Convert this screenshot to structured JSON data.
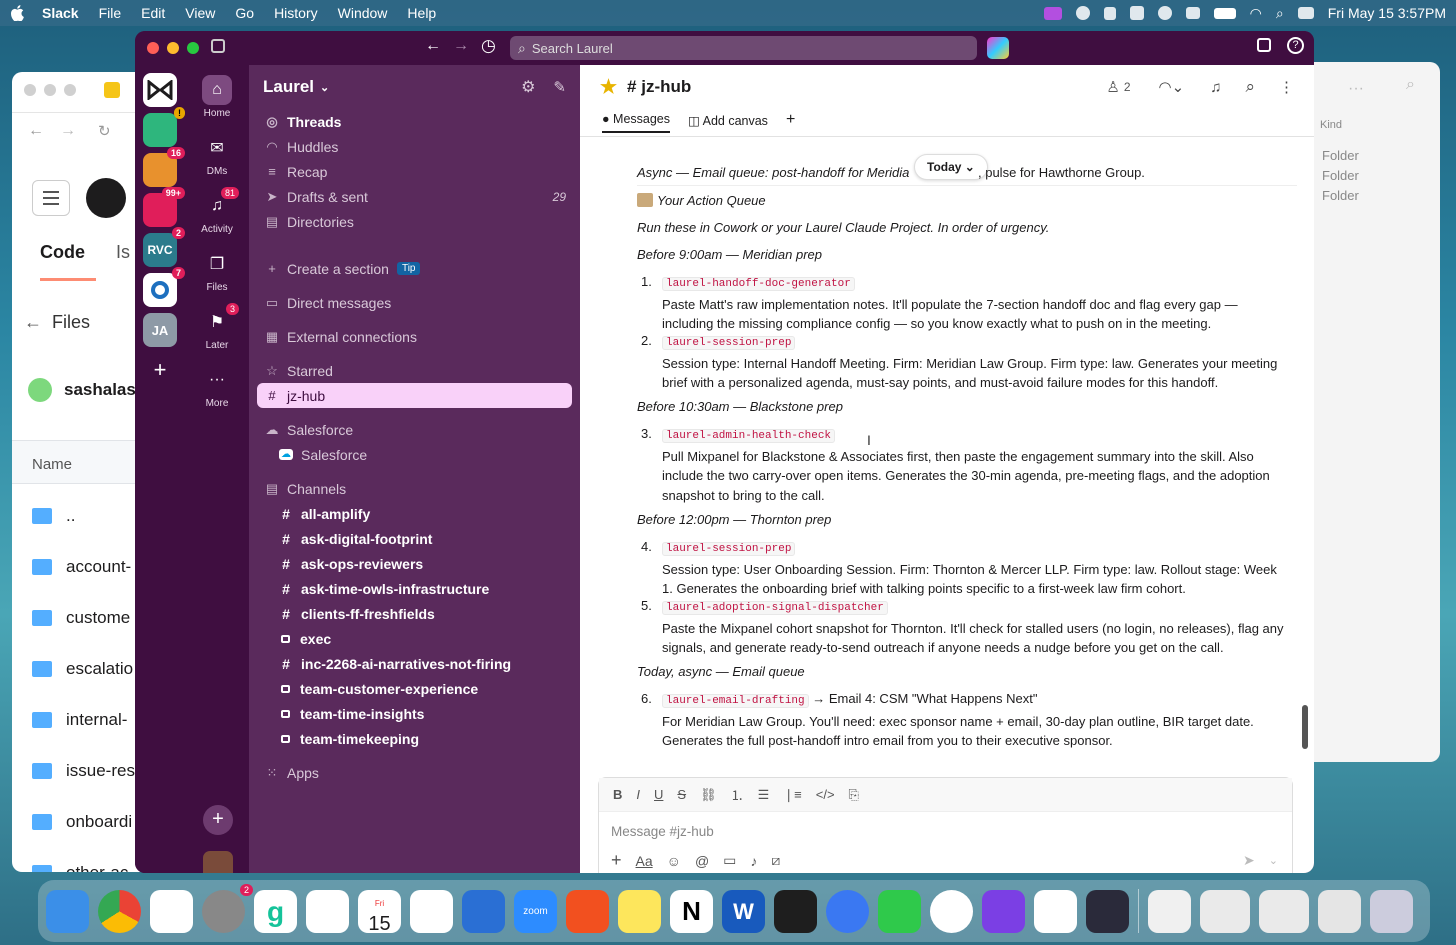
{
  "menubar": {
    "app": "Slack",
    "items": [
      "File",
      "Edit",
      "View",
      "Go",
      "History",
      "Window",
      "Help"
    ],
    "clock": "Fri May 15  3:57PM",
    "battery_icon": "battery-icon"
  },
  "titlebar": {
    "search_placeholder": "Search Laurel"
  },
  "workspace_rail": {
    "items": [
      {
        "name": "laurel-workspace",
        "label": ""
      },
      {
        "name": "workspace-2",
        "label": ""
      },
      {
        "name": "workspace-3",
        "label": "",
        "badge": "16"
      },
      {
        "name": "workspace-4",
        "label": "",
        "badge": "99+"
      },
      {
        "name": "workspace-rvc",
        "label": "RVC",
        "badge": "2"
      },
      {
        "name": "workspace-6",
        "label": "",
        "badge": "7"
      },
      {
        "name": "workspace-ja",
        "label": "JA"
      }
    ],
    "add": "+"
  },
  "nav": {
    "home": "Home",
    "dms": "DMs",
    "activity": "Activity",
    "activity_badge": "81",
    "files": "Files",
    "later": "Later",
    "later_badge": "3",
    "more": "More"
  },
  "sidebar": {
    "workspace": "Laurel",
    "top": [
      "Threads",
      "Huddles",
      "Recap",
      "Drafts & sent",
      "Directories"
    ],
    "drafts_count": "29",
    "create_section": "Create a section",
    "tip": "Tip",
    "direct_messages": "Direct messages",
    "external": "External connections",
    "starred": "Starred",
    "starred_channel": "jz-hub",
    "salesforce_section": "Salesforce",
    "salesforce_item": "Salesforce",
    "channels_header": "Channels",
    "channels": [
      {
        "name": "all-amplify",
        "icon": "#"
      },
      {
        "name": "ask-digital-footprint",
        "icon": "#"
      },
      {
        "name": "ask-ops-reviewers",
        "icon": "#"
      },
      {
        "name": "ask-time-owls-infrastructure",
        "icon": "#"
      },
      {
        "name": "clients-ff-freshfields",
        "icon": "#"
      },
      {
        "name": "exec",
        "icon": "lock"
      },
      {
        "name": "inc-2268-ai-narratives-not-firing",
        "icon": "#"
      },
      {
        "name": "team-customer-experience",
        "icon": "lock"
      },
      {
        "name": "team-time-insights",
        "icon": "lock"
      },
      {
        "name": "team-timekeeping",
        "icon": "lock"
      }
    ],
    "apps": "Apps"
  },
  "channel": {
    "name": "jz-hub",
    "members": "2",
    "tabs": [
      "Messages",
      "Add canvas"
    ]
  },
  "messages": {
    "async_line": "Async — Email queue: post-handoff for Meridian. Today … pulse for Hawthorne Group.",
    "async_left": "Async — Email queue: post-handoff for Meridia",
    "async_right": ", pulse for Hawthorne Group.",
    "date_pill": "Today",
    "queue_title": "Your Action Queue",
    "queue_sub": "Run these in Cowork or your Laurel Claude Project. In order of urgency.",
    "group1": "Before 9:00am — Meridian prep",
    "i1_code": "laurel-handoff-doc-generator",
    "i1_l1": "Paste Matt's raw implementation notes. It'll populate the 7-section handoff doc and flag every gap —",
    "i1_l2": "including the missing compliance config — so you know exactly what to push on in the meeting.",
    "i2_code": "laurel-session-prep",
    "i2_l1": "Session type: Internal Handoff Meeting. Firm: Meridian Law Group. Firm type: law. Generates your meeting",
    "i2_l2": "brief with a personalized agenda, must-say points, and must-avoid failure modes for this handoff.",
    "group2": "Before 10:30am — Blackstone prep",
    "i3_code": "laurel-admin-health-check",
    "i3_l1": "Pull Mixpanel for Blackstone & Associates first, then paste the engagement summary into the skill. Also",
    "i3_l2": "include the two carry-over open items. Generates the 30-min agenda, pre-meeting flags, and the adoption",
    "i3_l3": "snapshot to bring to the call.",
    "group3": "Before 12:00pm — Thornton prep",
    "i4_code": "laurel-session-prep",
    "i4_l1": "Session type: User Onboarding Session. Firm: Thornton & Mercer LLP. Firm type: law. Rollout stage: Week",
    "i4_l2": "1. Generates the onboarding brief with talking points specific to a first-week law firm cohort.",
    "i5_code": "laurel-adoption-signal-dispatcher",
    "i5_l1": "Paste the Mixpanel cohort snapshot for Thornton. It'll check for stalled users (no login, no releases), flag any",
    "i5_l2": "signals, and generate ready-to-send outreach if anyone needs a nudge before you get on the call.",
    "group4": "Today, async — Email queue",
    "i6_code": "laurel-email-drafting",
    "i6_after": "→ Email 4: CSM \"What Happens Next\"",
    "i6_l1": "For Meridian Law Group. You'll need: exec sponsor name + email, 30-day plan outline, BIR target date.",
    "i6_l2": "Generates the full post-handoff intro email from you to their executive sponsor."
  },
  "composer": {
    "placeholder": "Message #jz-hub"
  },
  "bg_left": {
    "tab": "Code",
    "files": "Files",
    "user": "sashalas",
    "name_col": "Name",
    "rows": [
      "..",
      "account-",
      "custome",
      "escalatio",
      "internal-",
      "issue-res",
      "onboardi",
      "other-ac"
    ]
  },
  "bg_right": {
    "kind": "Kind",
    "rows": [
      "Folder",
      "Folder",
      "Folder"
    ]
  },
  "dock": {
    "calendar_day": "15",
    "calendar_month": "Fri",
    "settings_badge": "2"
  }
}
